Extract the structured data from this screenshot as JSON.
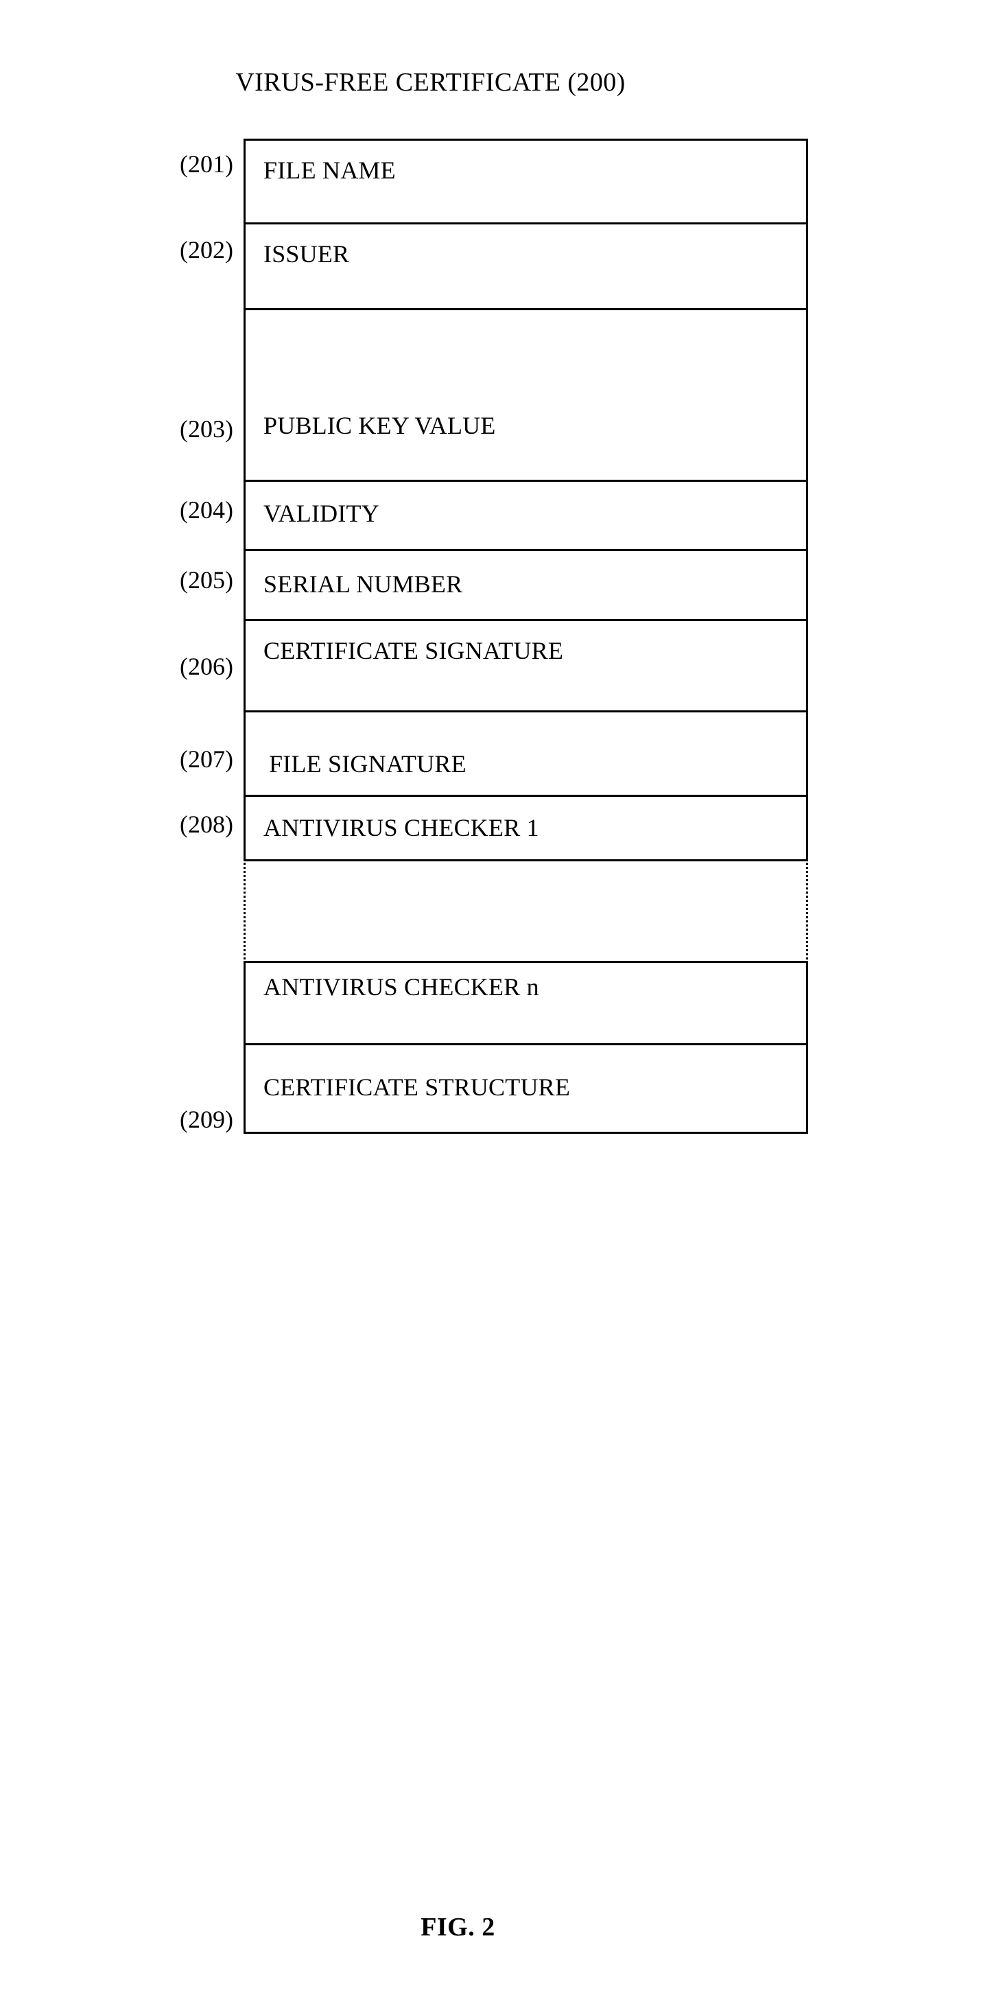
{
  "figure": {
    "title": "VIRUS-FREE CERTIFICATE (200)",
    "caption": "FIG. 2",
    "reference_number": "200",
    "line_color": "#000000",
    "background_color": "#ffffff",
    "text_color": "#000000"
  },
  "certificate": {
    "name": "VIRUS-FREE CERTIFICATE",
    "rows": [
      {
        "ref": "(201)",
        "label": "FILE NAME"
      },
      {
        "ref": "(202)",
        "label": "ISSUER"
      },
      {
        "ref": "(203)",
        "label": "PUBLIC KEY VALUE"
      },
      {
        "ref": "(204)",
        "label": "VALIDITY"
      },
      {
        "ref": "(205)",
        "label": "SERIAL NUMBER"
      },
      {
        "ref": "(206)",
        "label": "CERTIFICATE SIGNATURE"
      },
      {
        "ref": "(207)",
        "label": "FILE  SIGNATURE"
      },
      {
        "ref": "(208)",
        "label": "ANTIVIRUS CHECKER 1"
      },
      {
        "ref": "",
        "label": ""
      },
      {
        "ref": "",
        "label": "ANTIVIRUS CHECKER n"
      },
      {
        "ref": "(209)",
        "label": "CERTIFICATE STRUCTURE"
      }
    ]
  },
  "callouts": {
    "c201": "(201)",
    "c202": "(202)",
    "c203": "(203)",
    "c204": "(204)",
    "c205": "(205)",
    "c206": "(206)",
    "c207": "(207)",
    "c208": "(208)",
    "c209": "(209)"
  }
}
